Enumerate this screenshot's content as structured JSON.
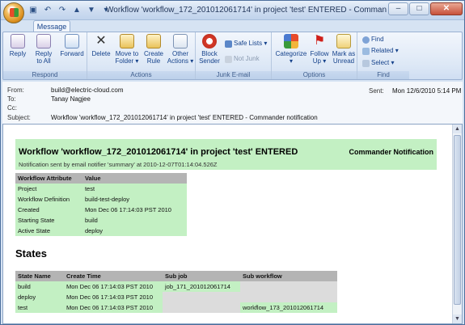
{
  "window": {
    "title": "Workflow  'workflow_172_201012061714'  in project  'test'  ENTERED  - Commander notification",
    "controls": [
      "–",
      "□",
      "✕"
    ]
  },
  "ribbon": {
    "tab": "Message",
    "groups": {
      "respond": {
        "label": "Respond",
        "reply": "Reply",
        "reply_all_1": "Reply",
        "reply_all_2": "to All",
        "forward": "Forward"
      },
      "actions": {
        "label": "Actions",
        "delete": "Delete",
        "move_1": "Move to",
        "move_2": "Folder ▾",
        "create_1": "Create",
        "create_2": "Rule",
        "other_1": "Other",
        "other_2": "Actions ▾"
      },
      "junk": {
        "label": "Junk E-mail",
        "block_1": "Block",
        "block_2": "Sender",
        "safe_lists": "Safe Lists ▾",
        "not_junk": "Not Junk"
      },
      "options": {
        "label": "Options",
        "categorize_1": "Categorize",
        "categorize_2": "▾",
        "follow_1": "Follow",
        "follow_2": "Up ▾",
        "mark_1": "Mark as",
        "mark_2": "Unread"
      },
      "find": {
        "label": "Find",
        "find": "Find",
        "related": "Related ▾",
        "select": "Select ▾"
      }
    }
  },
  "header": {
    "from_label": "From:",
    "from": "build@electric-cloud.com",
    "to_label": "To:",
    "to": "Tanay Nagjee",
    "cc_label": "Cc:",
    "cc": "",
    "subject_label": "Subject:",
    "subject": "Workflow  'workflow_172_201012061714'  in project  'test'  ENTERED  - Commander notification",
    "sent_label": "Sent:",
    "sent": "Mon 12/6/2010 5:14 PM"
  },
  "message": {
    "title": "Workflow 'workflow_172_201012061714' in project 'test' ENTERED",
    "right": "Commander Notification",
    "subtitle": "Notification sent by email notifier 'summary' at 2010-12-07T01:14:04.526Z",
    "attr_headers": [
      "Workflow Attribute",
      "Value"
    ],
    "attributes": [
      [
        "Project",
        "test"
      ],
      [
        "Workflow Definition",
        "build-test-deploy"
      ],
      [
        "Created",
        "Mon Dec 06 17:14:03 PST 2010"
      ],
      [
        "Starting State",
        "build"
      ],
      [
        "Active State",
        "deploy"
      ]
    ],
    "states_title": "States",
    "state_headers": [
      "State Name",
      "Create Time",
      "Sub job",
      "Sub workflow"
    ],
    "states": [
      [
        "build",
        "Mon Dec 06 17:14:03 PST 2010",
        "job_171_201012061714",
        ""
      ],
      [
        "deploy",
        "Mon Dec 06 17:14:03 PST 2010",
        "",
        ""
      ],
      [
        "test",
        "Mon Dec 06 17:14:03 PST 2010",
        "",
        "workflow_173_201012061714"
      ]
    ]
  }
}
